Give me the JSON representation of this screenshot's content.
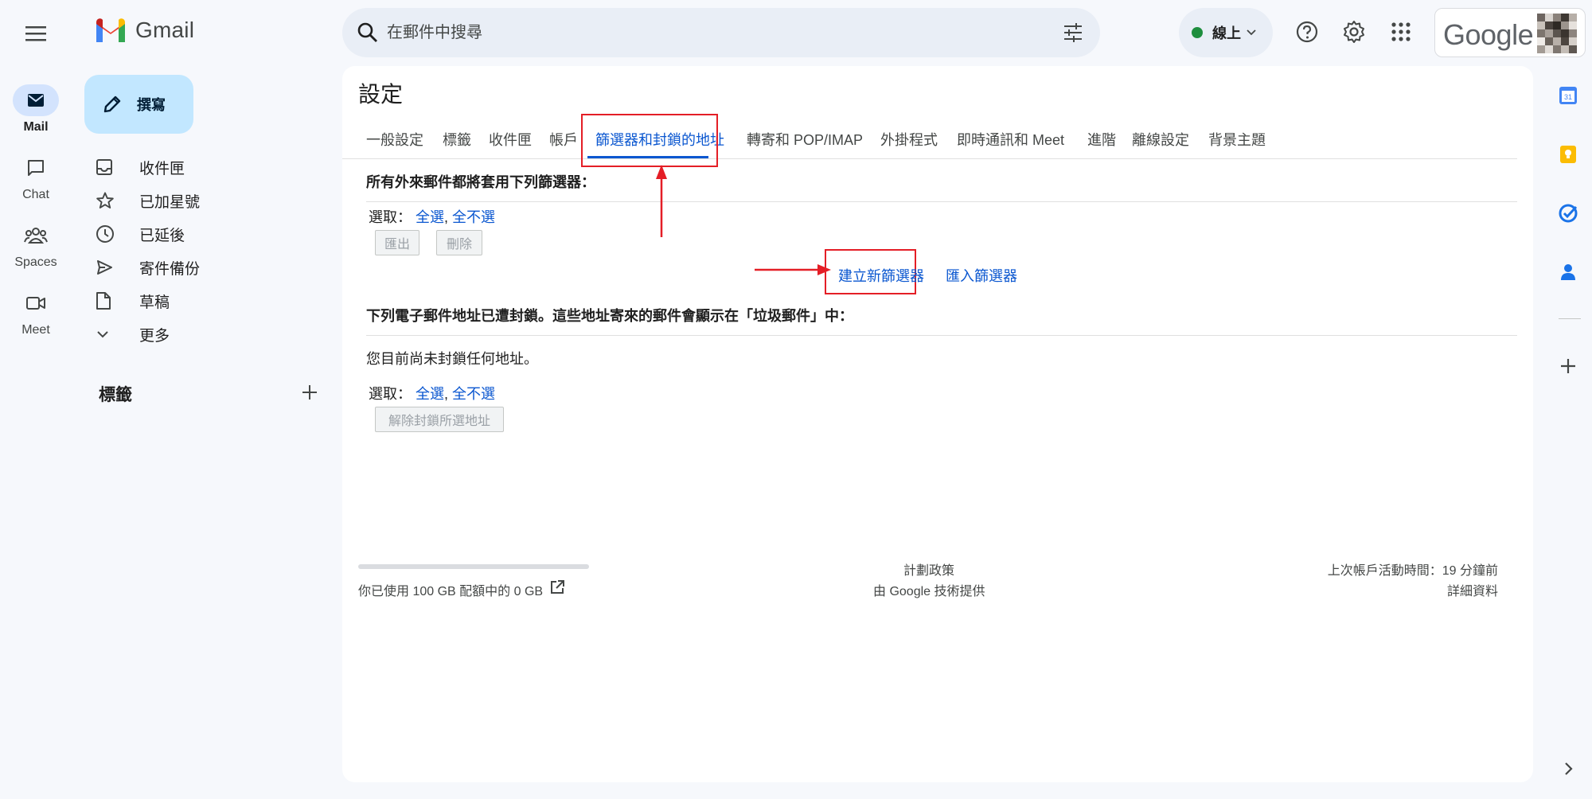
{
  "rail": {
    "items": [
      {
        "label": "Mail",
        "icon": "mail-icon",
        "active": true
      },
      {
        "label": "Chat",
        "icon": "chat-icon",
        "active": false
      },
      {
        "label": "Spaces",
        "icon": "spaces-icon",
        "active": false
      },
      {
        "label": "Meet",
        "icon": "meet-icon",
        "active": false
      }
    ]
  },
  "brand": {
    "name": "Gmail"
  },
  "search": {
    "placeholder": "在郵件中搜尋"
  },
  "status": {
    "label": "線上",
    "color": "#1e8e3e"
  },
  "account": {
    "google_wordmark": "Google"
  },
  "compose": {
    "label": "撰寫"
  },
  "nav": {
    "items": [
      {
        "label": "收件匣",
        "icon": "inbox-icon"
      },
      {
        "label": "已加星號",
        "icon": "star-icon"
      },
      {
        "label": "已延後",
        "icon": "clock-icon"
      },
      {
        "label": "寄件備份",
        "icon": "send-icon"
      },
      {
        "label": "草稿",
        "icon": "draft-icon"
      },
      {
        "label": "更多",
        "icon": "chevron-down-icon"
      }
    ],
    "labels_heading": "標籤"
  },
  "settings": {
    "title": "設定",
    "tabs": [
      {
        "label": "一般設定"
      },
      {
        "label": "標籤"
      },
      {
        "label": "收件匣"
      },
      {
        "label": "帳戶"
      },
      {
        "label": "篩選器和封鎖的地址",
        "active": true
      },
      {
        "label": "轉寄和 POP/IMAP"
      },
      {
        "label": "外掛程式"
      },
      {
        "label": "即時通訊和 Meet"
      },
      {
        "label": "進階"
      },
      {
        "label": "離線設定"
      },
      {
        "label": "背景主題"
      }
    ],
    "filters": {
      "heading": "所有外來郵件都將套用下列篩選器：",
      "select_label": "選取：",
      "select_all": "全選",
      "separator": ",",
      "select_none": "全不選",
      "export_label": "匯出",
      "delete_label": "刪除",
      "create_filter": "建立新篩選器",
      "import_filters": "匯入篩選器"
    },
    "blocked": {
      "heading": "下列電子郵件地址已遭封鎖。這些地址寄來的郵件會顯示在「垃圾郵件」中：",
      "empty_text": "您目前尚未封鎖任何地址。",
      "select_label": "選取：",
      "select_all": "全選",
      "separator": ",",
      "select_none": "全不選",
      "unblock_label": "解除封鎖所選地址"
    }
  },
  "footer": {
    "storage_text": "你已使用 100 GB 配額中的 0 GB",
    "storage_used_fraction": 0,
    "policy": "計劃政策",
    "powered_by": "由 Google 技術提供",
    "last_activity": "上次帳戶活動時間：19 分鐘前",
    "details": "詳細資料"
  },
  "annotations": {
    "highlight_color": "#e41e26"
  }
}
